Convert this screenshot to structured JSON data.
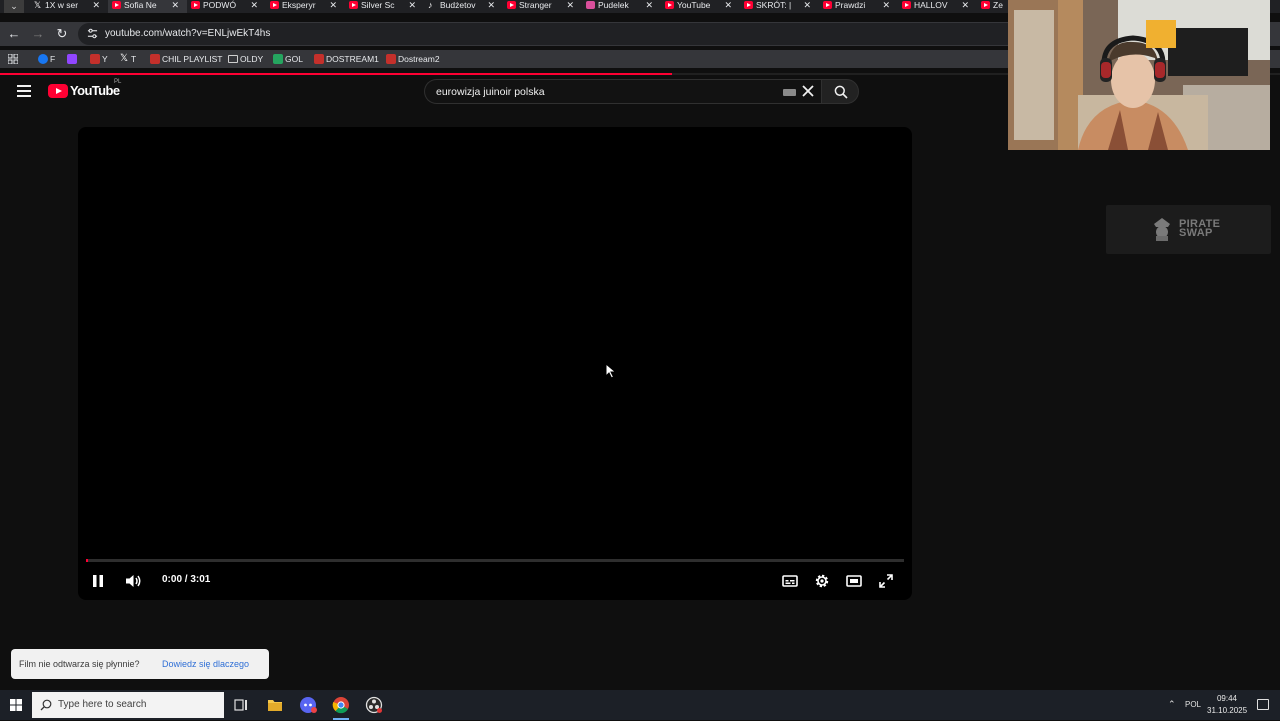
{
  "browser": {
    "tab_menu_icon": "chevron-down-icon",
    "tabs": [
      {
        "title": "1X w ser",
        "icon": "x",
        "active": false
      },
      {
        "title": "Sofia Ne",
        "icon": "yt",
        "active": true
      },
      {
        "title": "PODWÓ",
        "icon": "yt",
        "active": false
      },
      {
        "title": "Eksperyr",
        "icon": "yt",
        "active": false
      },
      {
        "title": "Silver Sc",
        "icon": "yt",
        "active": false
      },
      {
        "title": "Budżetov",
        "icon": "tt",
        "active": false
      },
      {
        "title": "Stranger",
        "icon": "yt",
        "active": false
      },
      {
        "title": "Pudelek",
        "icon": "pu",
        "active": false
      },
      {
        "title": "YouTube",
        "icon": "yt",
        "active": false
      },
      {
        "title": "SKRÓT: |",
        "icon": "yt",
        "active": false
      },
      {
        "title": "Prawdzi",
        "icon": "yt",
        "active": false
      },
      {
        "title": "HALLOV",
        "icon": "yt",
        "active": false
      },
      {
        "title": "Ze",
        "icon": "yt",
        "active": false
      }
    ],
    "tab_close_glyph": "✕",
    "url": "youtube.com/watch?v=ENLjwEkT4hs",
    "load_progress": 0.525,
    "bookmarks": [
      {
        "label": "F",
        "icon": "fb"
      },
      {
        "label": "",
        "icon": "tw"
      },
      {
        "label": "Y",
        "icon": "yt"
      },
      {
        "label": "T",
        "icon": "x"
      },
      {
        "label": "CHIL PLAYLIST",
        "icon": "yt"
      },
      {
        "label": "OLDY",
        "icon": "fold"
      },
      {
        "label": "GOL",
        "icon": "gol"
      },
      {
        "label": "DOSTREAM1",
        "icon": "yt"
      },
      {
        "label": "Dostream2",
        "icon": "yt"
      }
    ]
  },
  "youtube": {
    "logo_text": "YouTube",
    "country_code": "PL",
    "search_query": "eurowizja juinoir polska"
  },
  "player": {
    "current_time": "0:00",
    "duration": "3:01",
    "time_display": "0:00 / 3:01",
    "progress": 0.003
  },
  "ad": {
    "text_line1": "PIRATE",
    "text_line2": "SWAP"
  },
  "toast": {
    "message": "Film nie odtwarza się płynnie?",
    "link": "Dowiedz się dlaczego"
  },
  "taskbar": {
    "search_placeholder": "Type here to search",
    "language": "POL",
    "time": "09:44",
    "date": "31.10.2025"
  },
  "colors": {
    "youtube_red": "#ff0033",
    "page_bg": "#0f0f0f",
    "link_blue": "#2f6fd6"
  }
}
